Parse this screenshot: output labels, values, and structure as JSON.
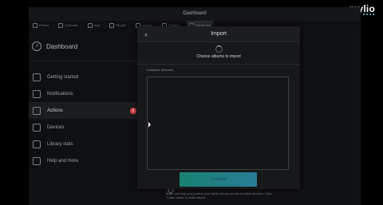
{
  "brand": {
    "name": "mylio",
    "accent": "#6fd3e0"
  },
  "window": {
    "title": "Dashboard"
  },
  "tabs": [
    {
      "label": "Photos",
      "icon": "photos-icon",
      "active": false
    },
    {
      "label": "Calendar",
      "icon": "calendar-icon",
      "active": false
    },
    {
      "label": "Map",
      "icon": "map-icon",
      "active": false
    },
    {
      "label": "People",
      "icon": "people-icon",
      "active": false
    },
    {
      "label": "Albums",
      "icon": "albums-icon",
      "active": false
    },
    {
      "label": "Folders",
      "icon": "folders-icon",
      "active": false
    },
    {
      "label": "Dashboard",
      "icon": "dashboard-icon",
      "active": true
    }
  ],
  "sidebar": {
    "title": "Dashboard",
    "items": [
      {
        "label": "Getting started",
        "icon": "rocket-icon"
      },
      {
        "label": "Notifications",
        "icon": "bell-icon"
      },
      {
        "label": "Actions",
        "icon": "actions-icon",
        "badge": "1"
      },
      {
        "label": "Devices",
        "icon": "devices-icon"
      },
      {
        "label": "Library stats",
        "icon": "stats-icon"
      },
      {
        "label": "Help and more",
        "icon": "help-icon"
      }
    ]
  },
  "modal": {
    "title": "Import",
    "subtitle": "Choose albums to import",
    "selected_count": "0 Albums Selected",
    "continue_label": "Continue"
  },
  "promo": {
    "title": "Protect your files",
    "body": "Mylio can help you protect your Mylio Library across multiple devices. Click \"Learn more\" to learn about"
  },
  "colors": {
    "badge": "#e0464f",
    "button_start": "#1aa58f",
    "button_end": "#2f9fc2"
  }
}
